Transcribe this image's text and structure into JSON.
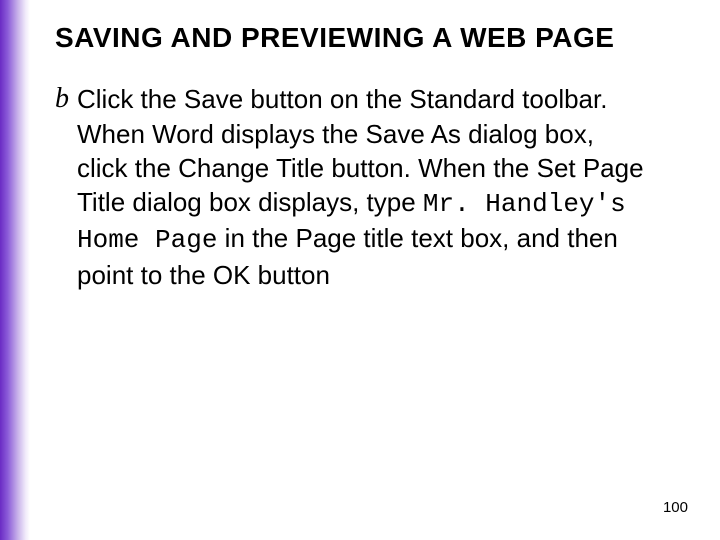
{
  "accent_color": "#6a2bc4",
  "title": "SAVING AND PREVIEWING A WEB PAGE",
  "bullet_glyph": "b",
  "body": {
    "pre": "Click the Save button on the Standard toolbar.  When Word displays the Save As dialog box, click the Change Title button.  When the Set Page Title dialog box displays, type ",
    "mono": "Mr. Handley's Home Page",
    "post": " in the Page title text box, and then point to the OK button"
  },
  "page_number": "100"
}
